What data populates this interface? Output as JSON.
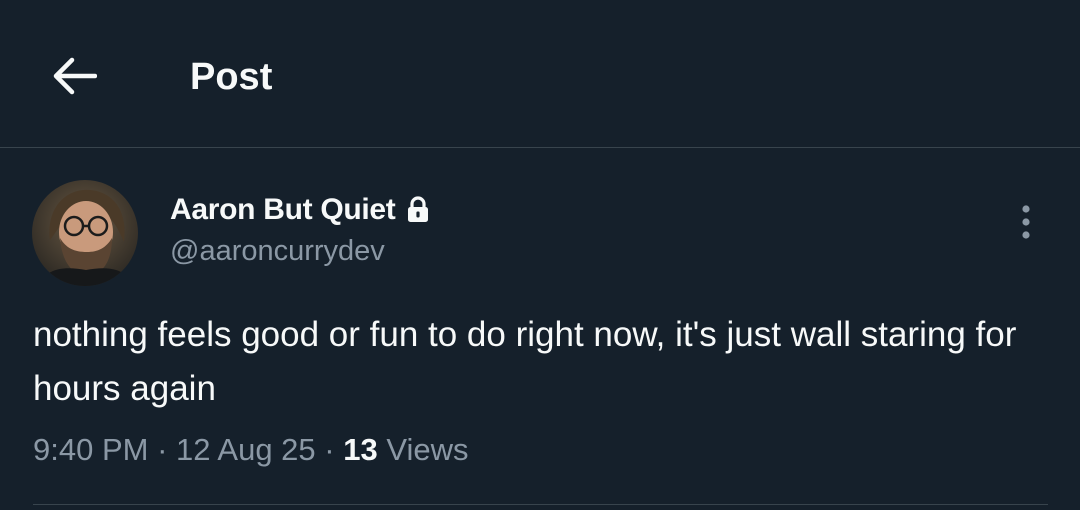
{
  "header": {
    "back_icon": "arrow-left-icon",
    "title": "Post"
  },
  "post": {
    "author": {
      "display_name": "Aaron But Quiet",
      "handle": "@aaroncurrydev",
      "protected_icon": "lock-icon"
    },
    "more_icon": "more-vertical-icon",
    "text": "nothing feels good or fun to do right now, it's just wall staring for hours again",
    "meta": {
      "time": "9:40 PM",
      "separator": " · ",
      "date": "12 Aug 25",
      "views_count": "13",
      "views_label": "Views"
    }
  },
  "colors": {
    "background": "#15202b",
    "text_primary": "#f7f9f9",
    "text_secondary": "#8b98a5",
    "border": "#38444d"
  }
}
